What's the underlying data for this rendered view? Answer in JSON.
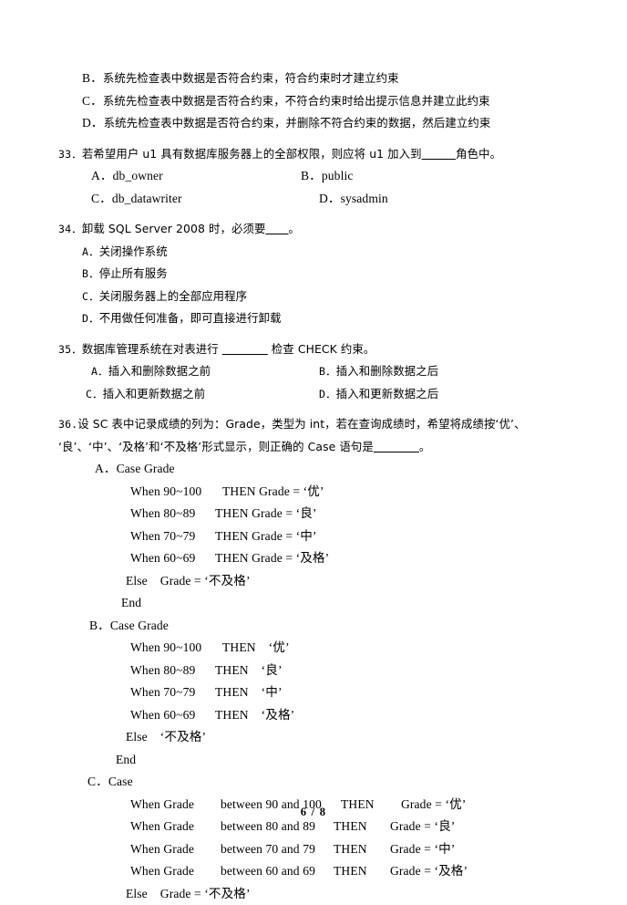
{
  "document": {
    "page_label": "6 / 8",
    "language": "zh-CN"
  },
  "carryover_options": {
    "items": [
      {
        "letter": "B．",
        "text": "系统先检查表中数据是否符合约束，符合约束时才建立约束"
      },
      {
        "letter": "C．",
        "text": "系统先检查表中数据是否符合约束，不符合约束时给出提示信息并建立此约束"
      },
      {
        "letter": "D．",
        "text": "系统先检查表中数据是否符合约束，并删除不符合约束的数据，然后建立约束"
      }
    ]
  },
  "questions": [
    {
      "number": "33．",
      "stem_part1": "若希望用户 u1 具有数据库服务器上的全部权限，则应将 u1 加入到",
      "blank": "＿＿＿",
      "stem_part2": "角色中。",
      "options": [
        {
          "letter": "A．",
          "text": "db_owner"
        },
        {
          "letter": "B．",
          "text": "public"
        },
        {
          "letter": "C．",
          "text": "db_datawriter"
        },
        {
          "letter": "D．",
          "text": "sysadmin"
        }
      ]
    },
    {
      "number": "34．",
      "stem_part1": "卸载 SQL  Server  2008 时，必须要",
      "blank": "＿＿",
      "stem_part2": "。",
      "options": [
        {
          "letter": "A．",
          "text": "关闭操作系统"
        },
        {
          "letter": "B．",
          "text": "停止所有服务"
        },
        {
          "letter": "C．",
          "text": "关闭服务器上的全部应用程序"
        },
        {
          "letter": "D．",
          "text": "不用做任何准备，即可直接进行卸载"
        }
      ]
    },
    {
      "number": "35．",
      "stem_part1": "数据库管理系统在对表进行 ",
      "blank": "＿＿＿＿",
      "stem_part2": " 检查 CHECK 约束。",
      "options": [
        {
          "letter": "A．",
          "text": "插入和删除数据之前"
        },
        {
          "letter": "B．",
          "text": "插入和删除数据之后"
        },
        {
          "letter": "C．",
          "text": "插入和更新数据之前"
        },
        {
          "letter": "D．",
          "text": "插入和更新数据之后"
        }
      ]
    },
    {
      "number": "36.",
      "stem_line1": "设 SC 表中记录成绩的列为：Grade，类型为 int，若在查询成绩时，希望将成绩按‘优’、",
      "stem_line2_a": "‘良’、‘中’、‘及格’和‘不及格’形式显示，则正确的 Case 语句是",
      "stem_line2_blank": "＿＿＿＿",
      "stem_line2_b": "。",
      "options": [
        {
          "letter": "A．",
          "header": "Case Grade",
          "lines": [
            {
              "when": "When 90~100",
              "then": "THEN Grade = ‘优’"
            },
            {
              "when": "When 80~89",
              "then": "THEN Grade = ‘良’"
            },
            {
              "when": "When 70~79",
              "then": "THEN Grade = ‘中’"
            },
            {
              "when": "When 60~69",
              "then": "THEN Grade = ‘及格’"
            }
          ],
          "else_line": "Else    Grade = ‘不及格’",
          "end_line": "End"
        },
        {
          "letter": "B．",
          "header": "Case Grade",
          "lines": [
            {
              "when": "When 90~100",
              "then": "THEN    ‘优’"
            },
            {
              "when": "When 80~89",
              "then": "THEN    ‘良’"
            },
            {
              "when": "When 70~79",
              "then": "THEN    ‘中’"
            },
            {
              "when": "When 60~69",
              "then": "THEN    ‘及格’"
            }
          ],
          "else_line": "Else    ‘不及格’",
          "end_line": "End"
        },
        {
          "letter": "C．",
          "header": "Case",
          "lines": [
            {
              "when": "When Grade",
              "range": "between 90 and 100",
              "then": "THEN",
              "result": "Grade = ‘优’"
            },
            {
              "when": "When Grade",
              "range": "between 80 and 89",
              "then": "THEN",
              "result": "Grade = ‘良’"
            },
            {
              "when": "When Grade",
              "range": "between 70 and 79",
              "then": "THEN",
              "result": "Grade = ‘中’"
            },
            {
              "when": "When Grade",
              "range": "between 60 and 69",
              "then": "THEN",
              "result": "Grade = ‘及格’"
            }
          ],
          "else_line": "Else    Grade = ‘不及格’"
        }
      ]
    }
  ]
}
